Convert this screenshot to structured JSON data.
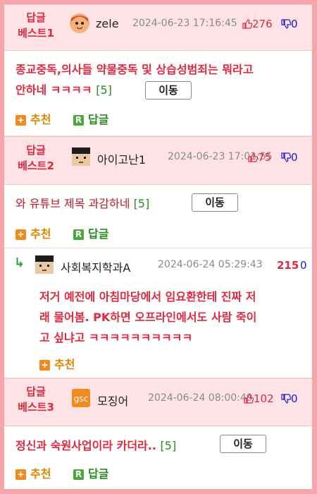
{
  "posts": [
    {
      "badge_line1": "답글",
      "badge_line2": "베스트1",
      "user": "zele",
      "time": "2024-06-23 17:16:45",
      "up": "276",
      "down": "0",
      "text_line1": "종교중독,의사들 약물중독 및 상습성범죄는 뭐라고",
      "text_line2": "안하네 ㅋㅋㅋㅋ",
      "count": "[5]",
      "move": "이동",
      "recommend": "추천",
      "reply": "답글"
    },
    {
      "badge_line1": "답글",
      "badge_line2": "베스트2",
      "user": "아이고난1",
      "time": "2024-06-23 17:01:55",
      "up": "75",
      "down": "0",
      "text_line1": "와 유튜브 제목 과감하네",
      "count": "[5]",
      "move": "이동",
      "recommend": "추천",
      "reply": "답글"
    },
    {
      "user": "사회복지학과A",
      "time": "2024-06-24 05:29:43",
      "up": "215",
      "down": "0",
      "text_line1": "저거 예전에 아침마당에서 임요환한테 진짜 저",
      "text_line2": "래 물어봄. PK하면 오프라인에서도 사람 죽이",
      "text_line3": "고 싶냐고 ㅋㅋㅋㅋㅋㅋㅋㅋㅋㅋ",
      "recommend": "추천"
    },
    {
      "badge_line1": "답글",
      "badge_line2": "베스트3",
      "user": "모징어",
      "time": "2024-06-24 08:00:49",
      "up": "102",
      "down": "0",
      "text_line1": "정신과 숙원사업이라 카더라..",
      "count": "[5]",
      "move": "이동",
      "recommend": "추천",
      "reply": "답글"
    }
  ],
  "colors": {
    "accent_red": "#e0283e",
    "header_bg": "#fde3e6",
    "frame_bg": "#f6a5ab",
    "recommend_orange": "#e08400",
    "reply_green": "#2b8a22",
    "down_blue": "#1a1ad0"
  },
  "icons": {
    "thumb_up": "thumb-up-icon",
    "thumb_down": "thumb-down-icon",
    "plus": "plus-icon",
    "reply_r": "reply-r-icon",
    "reply_arrow": "reply-arrow-icon"
  }
}
